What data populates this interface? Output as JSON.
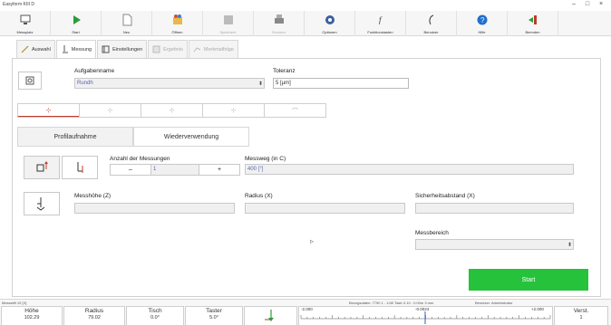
{
  "window": {
    "title": "Easyform KIII D"
  },
  "toolbar": [
    {
      "label": "Messplatz",
      "icon": "monitor-icon",
      "disabled": false
    },
    {
      "label": "Start",
      "icon": "play-icon",
      "disabled": false
    },
    {
      "label": "Neu",
      "icon": "new-document-icon",
      "disabled": false
    },
    {
      "label": "Öffnen",
      "icon": "open-folder-icon",
      "disabled": false
    },
    {
      "label": "Speichern",
      "icon": "save-icon",
      "disabled": true
    },
    {
      "label": "Drucken",
      "icon": "print-icon",
      "disabled": true
    },
    {
      "label": "Optionen",
      "icon": "gear-icon",
      "disabled": false
    },
    {
      "label": "Funktionstasten",
      "icon": "function-key-icon",
      "disabled": false
    },
    {
      "label": "Benutzer",
      "icon": "user-icon",
      "disabled": false
    },
    {
      "label": "Hilfe",
      "icon": "help-icon",
      "disabled": false
    },
    {
      "label": "Beenden",
      "icon": "exit-icon",
      "disabled": false
    }
  ],
  "tabs": [
    {
      "label": "Auswahl",
      "icon": "pen-icon",
      "active": false,
      "disabled": false
    },
    {
      "label": "Messung",
      "icon": "probe-icon",
      "active": true,
      "disabled": false
    },
    {
      "label": "Einstellungen",
      "icon": "settings-icon",
      "active": false,
      "disabled": false
    },
    {
      "label": "Ergebnis",
      "icon": "result-icon",
      "active": false,
      "disabled": true
    },
    {
      "label": "Merkmalfolge",
      "icon": "sequence-icon",
      "active": false,
      "disabled": true
    }
  ],
  "task": {
    "label": "Aufgabenname",
    "value": "Rundh",
    "tolerance_label": "Toleranz",
    "tolerance_value": "5 [µm]"
  },
  "mode_tabs": [
    "mode-1",
    "mode-2",
    "mode-3",
    "mode-4",
    "mode-5"
  ],
  "sub_tabs": {
    "profile": "Profilaufnahme",
    "reuse": "Wiederverwendung"
  },
  "measurement": {
    "count_label": "Anzahl der Messungen",
    "count_value": "1",
    "minus": "–",
    "plus": "+",
    "path_label": "Messweg (in C)",
    "path_value": "400 [°]",
    "height_label": "Messhöhe (Z)",
    "height_value": "",
    "radius_label": "Radius (X)",
    "radius_value": "",
    "safety_label": "Sicherheitsabstand (X)",
    "safety_value": "",
    "range_label": "Messbereich",
    "range_value": ""
  },
  "start_label": "Start",
  "status": {
    "left": "Messstift 19 [X]",
    "mid": "Bezugsdaten: 7790 1 - 1/40 Tastr 0.10 : 0.00m 3 mm",
    "right": "Benutzer: Administrator",
    "readouts": [
      {
        "label": "Höhe",
        "value": "102.29"
      },
      {
        "label": "Radius",
        "value": "79.02"
      },
      {
        "label": "Tisch",
        "value": "0.0°"
      },
      {
        "label": "Taster",
        "value": "5.0°"
      }
    ],
    "scale_min": "-2.000",
    "scale_mid": "-0.0024",
    "scale_max": "+2.000",
    "verst_label": "Verst.",
    "verst_value": "1"
  },
  "colors": {
    "accent": "#27c23c",
    "link_blue": "#5b62b5",
    "active_red": "#c0392b"
  }
}
